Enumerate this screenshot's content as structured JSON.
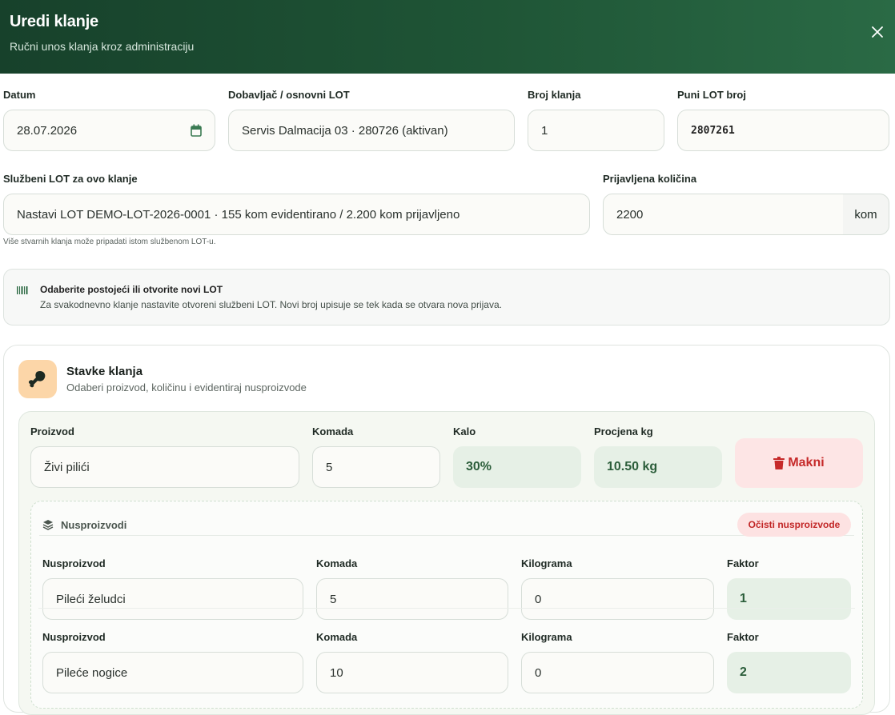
{
  "header": {
    "title": "Uredi klanje",
    "subtitle": "Ručni unos klanja kroz administraciju",
    "close_icon": "close-icon"
  },
  "form": {
    "datum_label": "Datum",
    "datum_value": "28.07.2026",
    "dobavljac_label": "Dobavljač / osnovni LOT",
    "dobavljac_value": "Servis Dalmacija 03 · 280726 (aktivan)",
    "broj_label": "Broj klanja",
    "broj_value": "1",
    "puni_lot_label": "Puni LOT broj",
    "puni_lot_value": "2807261",
    "sluzbeni_lot_label": "Službeni LOT za ovo klanje",
    "sluzbeni_lot_value": "Nastavi LOT DEMO-LOT-2026-0001 · 155 kom evidentirano / 2.200 kom prijavljeno",
    "sluzbeni_lot_help": "Više stvarnih klanja može pripadati istom službenom LOT-u.",
    "kolicina_label": "Prijavljena količina",
    "kolicina_value": "2200",
    "kolicina_unit": "kom"
  },
  "info": {
    "icon": "barcode-icon",
    "title": "Odaberite postojeći ili otvorite novi LOT",
    "text": "Za svakodnevno klanje nastavite otvoreni službeni LOT. Novi broj upisuje se tek kada se otvara nova prijava."
  },
  "items_card": {
    "icon": "drumstick-icon",
    "title": "Stavke klanja",
    "subtitle": "Odaberi proizvod, količinu i evidentiraj nusproizvode",
    "item": {
      "proizvod_label": "Proizvod",
      "proizvod_value": "Živi pilići",
      "komada_label": "Komada",
      "komada_value": "5",
      "kalo_label": "Kalo",
      "kalo_value": "30%",
      "procjena_label": "Procjena kg",
      "procjena_value": "10.50 kg",
      "remove_label": "Makni",
      "remove_icon": "trash-icon"
    },
    "byproducts": {
      "title": "Nusproizvodi",
      "icon": "layers-icon",
      "clear_label": "Očisti nusproizvode",
      "rows": [
        {
          "nus_label": "Nusproizvod",
          "nus_value": "Pileći želudci",
          "kom_label": "Komada",
          "kom_value": "5",
          "kg_label": "Kilograma",
          "kg_value": "0",
          "faktor_label": "Faktor",
          "faktor_value": "1"
        },
        {
          "nus_label": "Nusproizvod",
          "nus_value": "Pileće nogice",
          "kom_label": "Komada",
          "kom_value": "10",
          "kg_label": "Kilograma",
          "kg_value": "0",
          "faktor_label": "Faktor",
          "faktor_value": "2"
        }
      ]
    }
  },
  "colors": {
    "header_dark": "#17412b",
    "header_light": "#2a6a45",
    "accent_green": "#2b5d3a",
    "danger": "#c62a2a",
    "icon_bg": "#fcd6a8"
  }
}
